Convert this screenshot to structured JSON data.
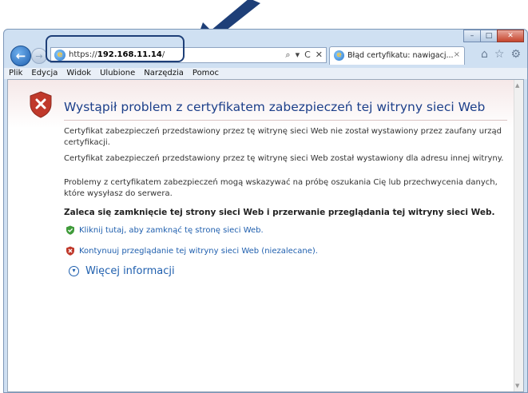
{
  "window": {
    "controls": {
      "minimize": "–",
      "maximize": "□",
      "close": "✕"
    }
  },
  "nav": {
    "back_icon": "←",
    "forward_icon": "→",
    "address": {
      "scheme": "https://",
      "host": "192.168.11.14",
      "path": "/"
    },
    "address_tools": {
      "search": "⌕",
      "dropdown": "▾",
      "refresh": "C",
      "stop": "✕"
    }
  },
  "tab": {
    "title": "Błąd certyfikatu: nawigacj...",
    "close": "×"
  },
  "toolbar_icons": {
    "home": "⌂",
    "favorites": "☆",
    "settings": "⚙"
  },
  "menu": [
    "Plik",
    "Edycja",
    "Widok",
    "Ulubione",
    "Narzędzia",
    "Pomoc"
  ],
  "page": {
    "headline": "Wystąpił problem z certyfikatem zabezpieczeń tej witryny sieci Web",
    "para1": "Certyfikat zabezpieczeń przedstawiony przez tę witrynę sieci Web nie został wystawiony przez zaufany urząd certyfikacji.",
    "para2": "Certyfikat zabezpieczeń przedstawiony przez tę witrynę sieci Web został wystawiony dla adresu innej witryny.",
    "para3": "Problemy z certyfikatem zabezpieczeń mogą wskazywać na próbę oszukania Cię lub przechwycenia danych, które wysyłasz do serwera.",
    "recommendation": "Zaleca się zamknięcie tej strony sieci Web i przerwanie przeglądania tej witryny sieci Web.",
    "link_close": "Kliknij tutaj, aby zamknąć tę stronę sieci Web.",
    "link_continue": "Kontynuuj przeglądanie tej witryny sieci Web (niezalecane).",
    "more_info": "Więcej informacji",
    "more_info_icon": "▾"
  },
  "scrollbar": {
    "up": "▲",
    "down": "▼"
  },
  "colors": {
    "headline": "#1c3f8a",
    "link": "#1f5fae",
    "annotation": "#1e3f78",
    "shield_red": "#c0392b",
    "shield_green": "#3f9b3a"
  }
}
